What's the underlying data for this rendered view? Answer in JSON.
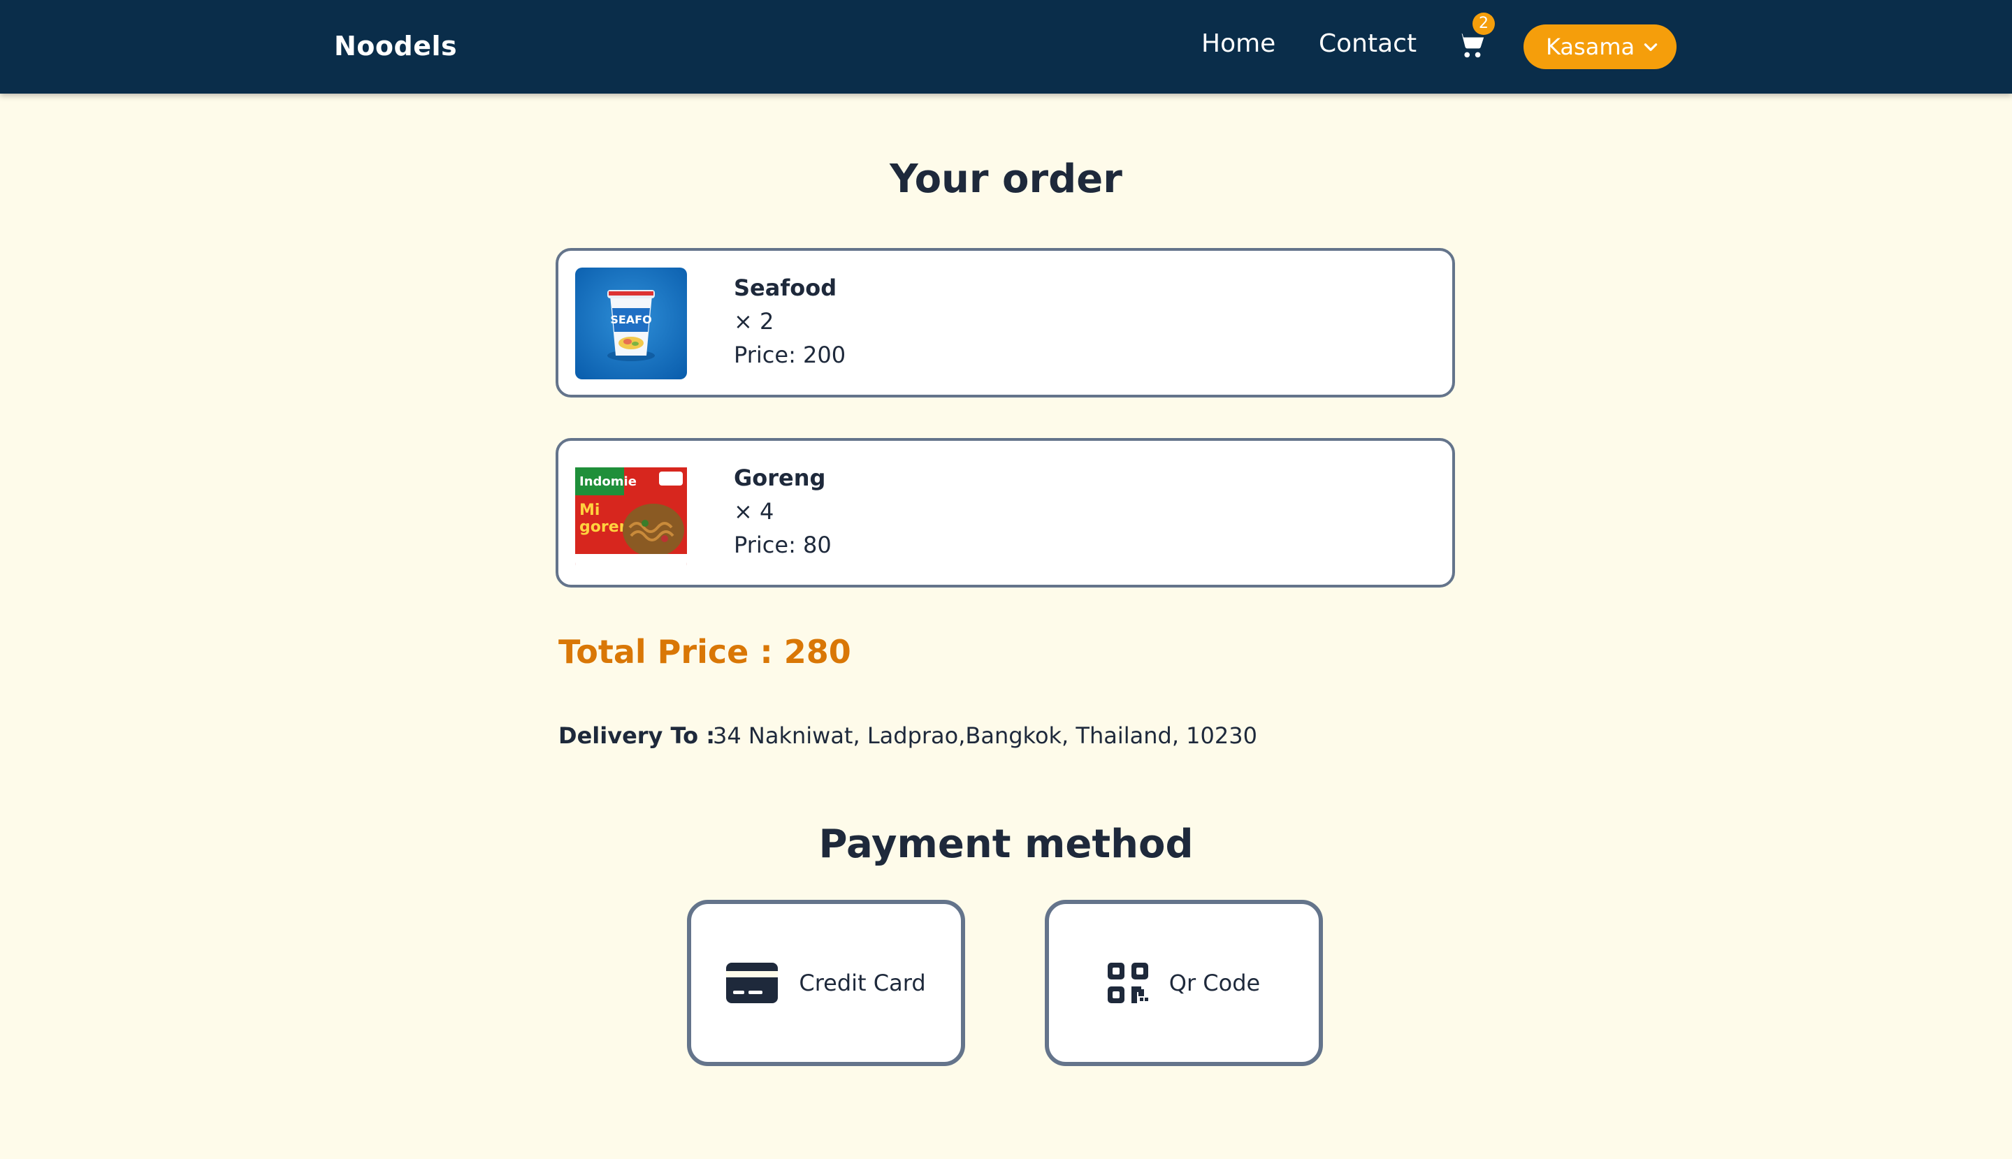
{
  "navbar": {
    "brand": "Noodels",
    "links": [
      "Home",
      "Contact"
    ],
    "cart_count": "2",
    "user_name": "Kasama",
    "icons": {
      "cart": "cart-icon",
      "dropdown": "chevron-down-icon"
    }
  },
  "order": {
    "title": "Your order",
    "items": [
      {
        "name": "Seafood",
        "qty": "× 2",
        "price": "Price: 200",
        "image": "seafood-cup-noodle-image"
      },
      {
        "name": "Goreng",
        "qty": "× 4",
        "price": "Price: 80",
        "image": "mi-goreng-pack-image"
      }
    ],
    "total_label": "Total Price : 280"
  },
  "delivery": {
    "label": "Delivery To :",
    "address": "34 Nakniwat, Ladprao,Bangkok, Thailand, 10230"
  },
  "payment": {
    "title": "Payment method",
    "methods": [
      {
        "label": "Credit Card",
        "icon": "credit-card-icon"
      },
      {
        "label": "Qr Code",
        "icon": "qr-code-icon"
      }
    ]
  },
  "colors": {
    "navbar_bg": "#0a2d4a",
    "page_bg": "#fefbea",
    "accent": "#f59e0b",
    "total_text": "#d97706",
    "border": "#64748b",
    "text": "#1e293b"
  }
}
